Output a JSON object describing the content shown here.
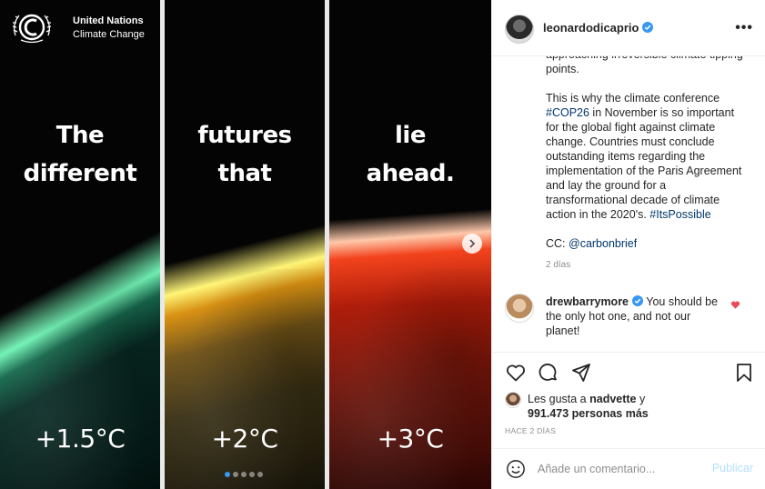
{
  "post": {
    "logo": {
      "line1": "United Nations",
      "line2": "Climate Change"
    },
    "panels": [
      {
        "words": [
          "The",
          "different"
        ],
        "temp": "+1.5°C"
      },
      {
        "words": [
          "futures",
          "that"
        ],
        "temp": "+2°C"
      },
      {
        "words": [
          "lie",
          "ahead."
        ],
        "temp": "+3°C"
      }
    ],
    "carousel": {
      "slide_count": 5,
      "active_slide": 1
    }
  },
  "sidebar": {
    "username": "leonardodicaprio",
    "caption": {
      "cut_text": "approaching irreversible climate tipping points.",
      "p2_before": "This is why the climate conference ",
      "p2_tag1": "#COP26",
      "p2_mid": " in November is so important for the global fight against climate change. Countries must conclude outstanding items regarding the implementation of the Paris Agreement and lay the ground for a transformational decade of climate action in the 2020's. ",
      "p2_tag2": "#ItsPossible",
      "cc_label": "CC: ",
      "cc_mention": "@carbonbrief",
      "ago": "2 días"
    },
    "comment": {
      "user": "drewbarrymore",
      "text": " You should be the only hot one, and not our planet!"
    },
    "likes": {
      "prefix": "Les gusta a ",
      "user": "nadvette",
      "joiner": " y",
      "count": "991.473 personas más"
    },
    "timestamp": "HACE 2 DÍAS",
    "add_comment": {
      "placeholder": "Añade un comentario...",
      "publish": "Publicar"
    },
    "colors": {
      "link": "#00376b",
      "verified": "#3897f0",
      "heart": "#ed4956",
      "publish": "#b2dffc"
    }
  }
}
